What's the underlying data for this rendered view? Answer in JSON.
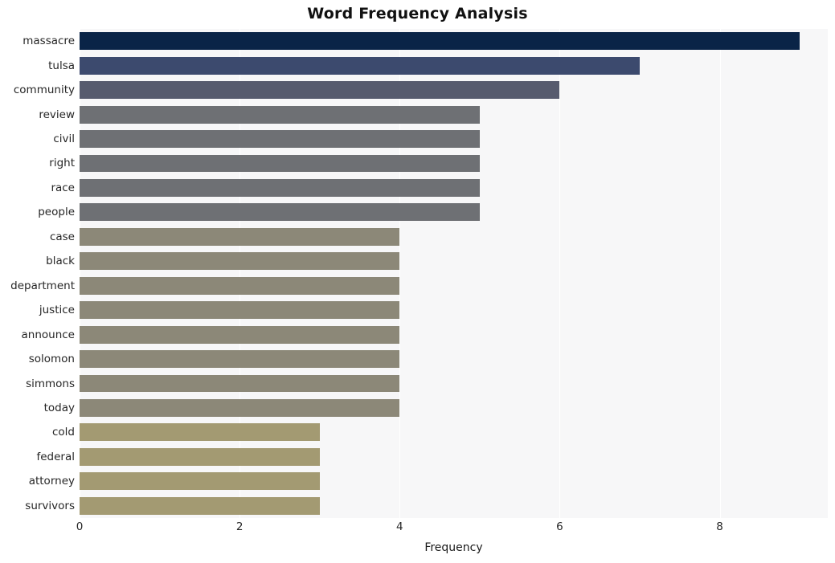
{
  "chart_data": {
    "type": "bar",
    "orientation": "horizontal",
    "title": "Word Frequency Analysis",
    "xlabel": "Frequency",
    "ylabel": "",
    "categories": [
      "massacre",
      "tulsa",
      "community",
      "review",
      "civil",
      "right",
      "race",
      "people",
      "case",
      "black",
      "department",
      "justice",
      "announce",
      "solomon",
      "simmons",
      "today",
      "cold",
      "federal",
      "attorney",
      "survivors"
    ],
    "values": [
      9,
      7,
      6,
      5,
      5,
      5,
      5,
      5,
      4,
      4,
      4,
      4,
      4,
      4,
      4,
      4,
      3,
      3,
      3,
      3
    ],
    "bar_colors": [
      "#0a2447",
      "#3c4a6e",
      "#575b6e",
      "#6e7074",
      "#6e7074",
      "#6e7074",
      "#6e7074",
      "#6e7074",
      "#8c8878",
      "#8c8878",
      "#8c8878",
      "#8c8878",
      "#8c8878",
      "#8c8878",
      "#8c8878",
      "#8c8878",
      "#a39a72",
      "#a39a72",
      "#a39a72",
      "#a39a72"
    ],
    "xticks": [
      "0",
      "2",
      "4",
      "6",
      "8"
    ],
    "xtick_values": [
      0,
      2,
      4,
      6,
      8
    ],
    "xlim": [
      0,
      9.35
    ],
    "grid": true,
    "grid_axis": "x",
    "legend": "none",
    "plot_background": "#f7f7f8",
    "figure_background": "#ffffff",
    "gridline_color": "#ffffff",
    "text_color": "#262626"
  }
}
